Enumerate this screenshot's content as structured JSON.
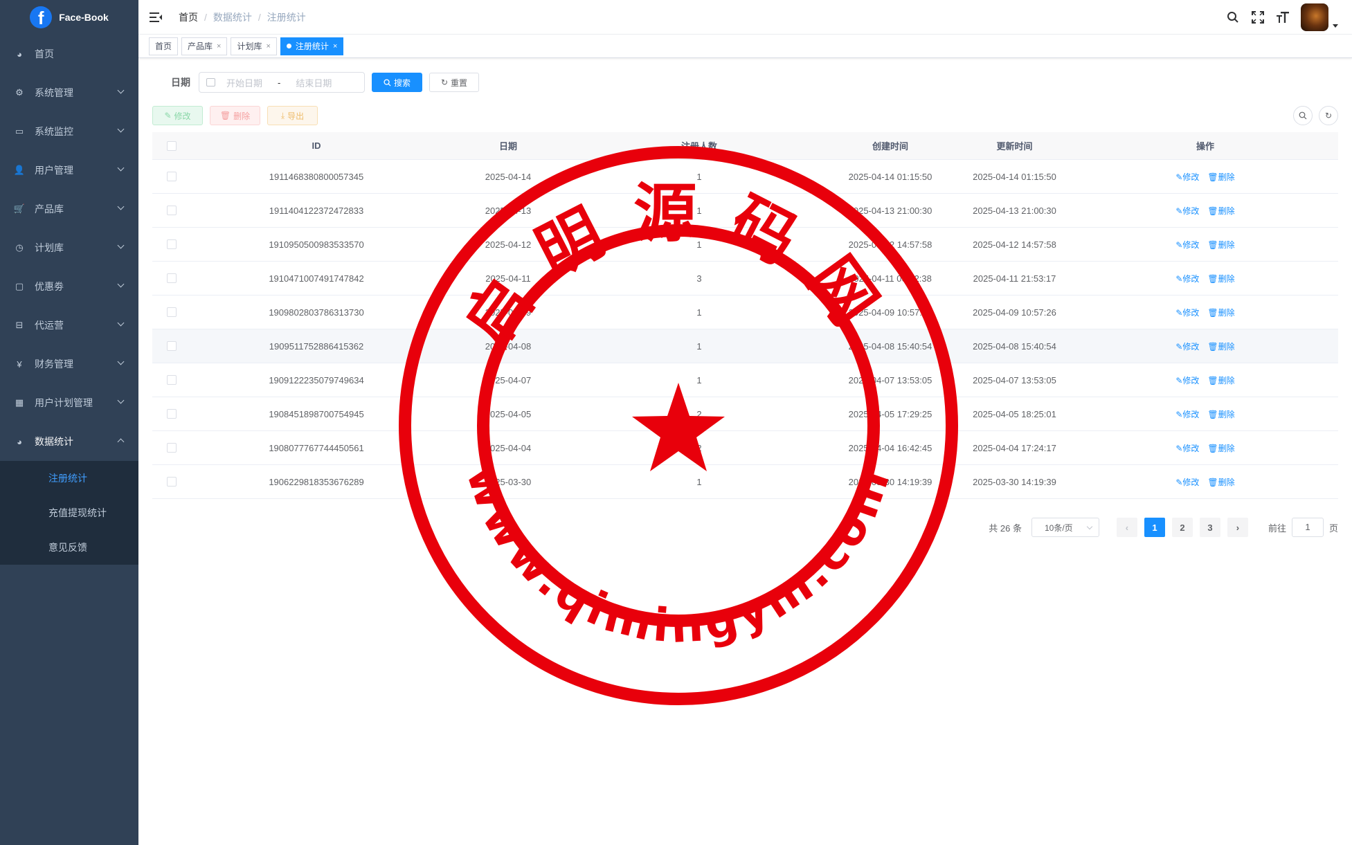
{
  "app": {
    "logo_letter": "f",
    "name": "Face-Book"
  },
  "sidebar": {
    "items": [
      {
        "label": "首页",
        "icon": "dashboard-icon",
        "has_children": false
      },
      {
        "label": "系统管理",
        "icon": "gear-icon",
        "has_children": true
      },
      {
        "label": "系统监控",
        "icon": "monitor-icon",
        "has_children": true
      },
      {
        "label": "用户管理",
        "icon": "user-icon",
        "has_children": true
      },
      {
        "label": "产品库",
        "icon": "cart-icon",
        "has_children": true
      },
      {
        "label": "计划库",
        "icon": "clock-icon",
        "has_children": true
      },
      {
        "label": "优惠劵",
        "icon": "coupon-icon",
        "has_children": true
      },
      {
        "label": "代运营",
        "icon": "tree-icon",
        "has_children": true
      },
      {
        "label": "财务管理",
        "icon": "yen-icon",
        "has_children": true
      },
      {
        "label": "用户计划管理",
        "icon": "grid-icon",
        "has_children": true
      },
      {
        "label": "数据统计",
        "icon": "dashboard-icon",
        "has_children": true,
        "open": true
      }
    ],
    "submenu": [
      {
        "label": "注册统计",
        "active": true
      },
      {
        "label": "充值提现统计",
        "active": false
      },
      {
        "label": "意见反馈",
        "active": false
      }
    ]
  },
  "breadcrumb": [
    "首页",
    "数据统计",
    "注册统计"
  ],
  "tags": [
    {
      "label": "首页",
      "closable": false,
      "active": false
    },
    {
      "label": "产品库",
      "closable": true,
      "active": false
    },
    {
      "label": "计划库",
      "closable": true,
      "active": false
    },
    {
      "label": "注册统计",
      "closable": true,
      "active": true
    }
  ],
  "search": {
    "date_label": "日期",
    "start_placeholder": "开始日期",
    "separator": "-",
    "end_placeholder": "结束日期",
    "search_button": "搜索",
    "reset_button": "重置"
  },
  "toolbar": {
    "edit": "修改",
    "delete": "删除",
    "export": "导出"
  },
  "table": {
    "columns": [
      "ID",
      "日期",
      "注册人数",
      "创建时间",
      "更新时间",
      "操作"
    ],
    "op_edit": "修改",
    "op_delete": "删除",
    "rows": [
      {
        "id": "1911468380800057345",
        "date": "2025-04-14",
        "count": "1",
        "created": "2025-04-14 01:15:50",
        "updated": "2025-04-14 01:15:50"
      },
      {
        "id": "1911404122372472833",
        "date": "2025-04-13",
        "count": "1",
        "created": "2025-04-13 21:00:30",
        "updated": "2025-04-13 21:00:30"
      },
      {
        "id": "1910950500983533570",
        "date": "2025-04-12",
        "count": "1",
        "created": "2025-04-12 14:57:58",
        "updated": "2025-04-12 14:57:58"
      },
      {
        "id": "1910471007491747842",
        "date": "2025-04-11",
        "count": "3",
        "created": "2025-04-11 00:12:38",
        "updated": "2025-04-11 21:53:17"
      },
      {
        "id": "1909802803786313730",
        "date": "2025-04-09",
        "count": "1",
        "created": "2025-04-09 10:57:26",
        "updated": "2025-04-09 10:57:26"
      },
      {
        "id": "1909511752886415362",
        "date": "2025-04-08",
        "count": "1",
        "created": "2025-04-08 15:40:54",
        "updated": "2025-04-08 15:40:54"
      },
      {
        "id": "1909122235079749634",
        "date": "2025-04-07",
        "count": "1",
        "created": "2025-04-07 13:53:05",
        "updated": "2025-04-07 13:53:05"
      },
      {
        "id": "1908451898700754945",
        "date": "2025-04-05",
        "count": "2",
        "created": "2025-04-05 17:29:25",
        "updated": "2025-04-05 18:25:01"
      },
      {
        "id": "1908077767744450561",
        "date": "2025-04-04",
        "count": "2",
        "created": "2025-04-04 16:42:45",
        "updated": "2025-04-04 17:24:17"
      },
      {
        "id": "1906229818353676289",
        "date": "2025-03-30",
        "count": "1",
        "created": "2025-03-30 14:19:39",
        "updated": "2025-03-30 14:19:39"
      }
    ]
  },
  "pagination": {
    "total": "共 26 条",
    "page_size": "10条/页",
    "pages": [
      "1",
      "2",
      "3"
    ],
    "current": "1",
    "goto_label": "前往",
    "goto_value": "1",
    "goto_suffix": "页"
  },
  "watermark": {
    "top_text": "启明源码网",
    "bottom_text": "www.qimingym.com",
    "color": "#e8000b"
  },
  "colors": {
    "sidebar_bg": "#304156",
    "submenu_bg": "#1f2d3d",
    "accent": "#1890ff"
  }
}
